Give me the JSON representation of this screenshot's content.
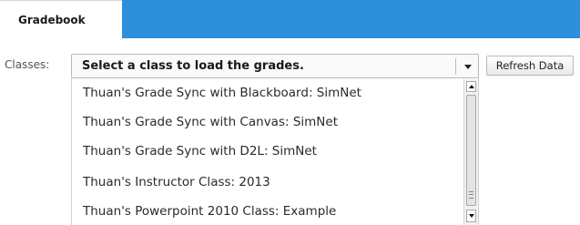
{
  "tabs": [
    {
      "label": "Gradebook",
      "active": true
    }
  ],
  "toolbar": {
    "classes_label": "Classes:",
    "select_value": "Select a class to load the grades.",
    "refresh_label": "Refresh Data"
  },
  "dropdown": {
    "items": [
      "Thuan's Grade Sync with Blackboard: SimNet",
      "Thuan's Grade Sync with Canvas: SimNet",
      "Thuan's Grade Sync with D2L: SimNet",
      "Thuan's Instructor Class: 2013",
      "Thuan's Powerpoint 2010 Class: Example"
    ]
  },
  "colors": {
    "tab_bar_blue": "#2e8fda"
  },
  "icons": {
    "select_arrow": "chevron-down-icon",
    "scroll_up": "scroll-up-arrow-icon",
    "scroll_down": "scroll-down-arrow-icon"
  }
}
